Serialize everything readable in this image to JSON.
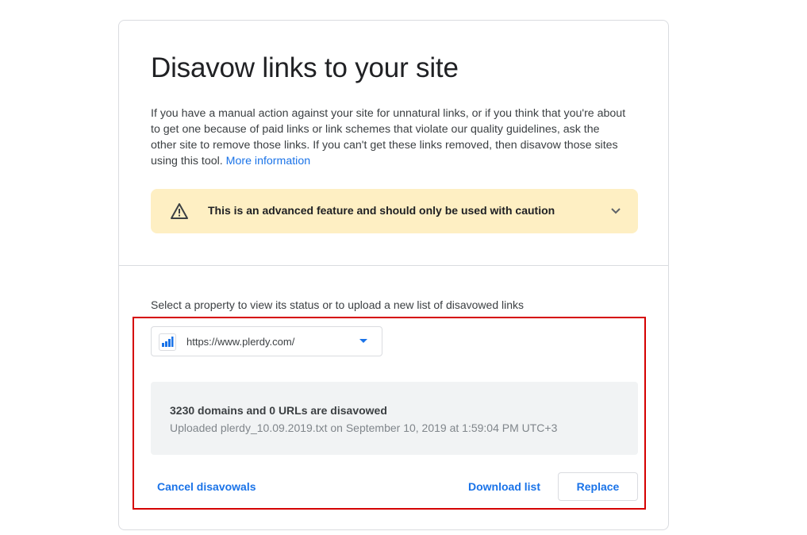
{
  "page": {
    "title": "Disavow links to your site",
    "intro_text": "If you have a manual action against your site for unnatural links, or if you think that you're about to get one because of paid links or link schemes that violate our quality guidelines, ask the other site to remove those links. If you can't get these links removed, then disavow those sites using this tool.",
    "more_info_link": "More information"
  },
  "warning": {
    "icon": "warning-triangle-icon",
    "text": "This is an advanced feature and should only be used with caution",
    "expand_icon": "chevron-down-icon"
  },
  "property": {
    "label": "Select a property to view its status or to upload a new list of disavowed links",
    "selected": "https://www.plerdy.com/",
    "icon": "search-console-property-icon"
  },
  "status": {
    "summary": "3230 domains and 0 URLs are disavowed",
    "uploaded": "Uploaded plerdy_10.09.2019.txt on September 10, 2019 at 1:59:04 PM UTC+3"
  },
  "actions": {
    "cancel_label": "Cancel disavowals",
    "download_label": "Download list",
    "replace_label": "Replace"
  },
  "colors": {
    "accent": "#1a73e8",
    "warning_bg": "#feefc3",
    "highlight_border": "#d50000",
    "status_bg": "#f1f3f4"
  }
}
